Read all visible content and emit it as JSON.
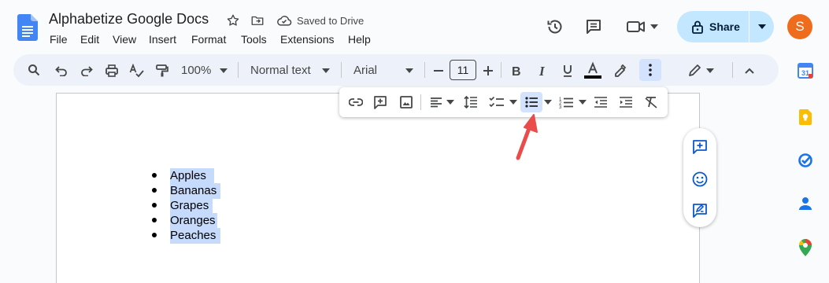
{
  "doc": {
    "title": "Alphabetize Google Docs",
    "save_status": "Saved to Drive",
    "avatar_letter": "S"
  },
  "menu": [
    "File",
    "Edit",
    "View",
    "Insert",
    "Format",
    "Tools",
    "Extensions",
    "Help"
  ],
  "header": {
    "share_label": "Share"
  },
  "toolbar": {
    "zoom": "100%",
    "style": "Normal text",
    "font": "Arial",
    "font_size": "11"
  },
  "document": {
    "list_items": [
      "Apples",
      "Bananas",
      "Grapes",
      "Oranges",
      "Peaches"
    ]
  },
  "colors": {
    "accent": "#0b57d0",
    "share_bg": "#c2e7ff",
    "selection": "#c6dafc",
    "avatar": "#f06c1d",
    "arrow": "#ea4c4c"
  }
}
